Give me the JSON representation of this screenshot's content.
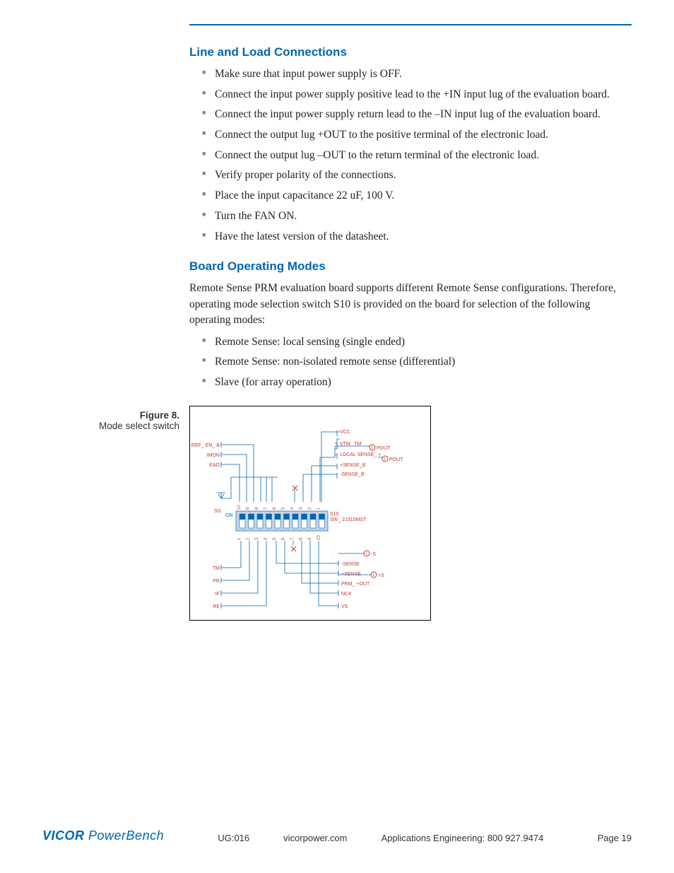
{
  "sections": {
    "line_load": {
      "title": "Line and Load Connections",
      "items": [
        "Make sure that input power supply is OFF.",
        "Connect the input power supply positive lead to the +IN input lug of the evaluation board.",
        "Connect the input power supply return lead to the –IN input lug of the evaluation board.",
        "Connect the output lug +OUT to the positive terminal of the electronic load.",
        "Connect the output lug –OUT to the return terminal of the electronic load.",
        "Verify proper polarity of the connections.",
        "Place the input capacitance 22 uF, 100 V.",
        "Turn the FAN ON.",
        "Have the latest version of the datasheet."
      ]
    },
    "board_modes": {
      "title": "Board Operating Modes",
      "intro": "Remote Sense PRM evaluation board supports different Remote Sense configurations. Therefore, operating mode selection switch S10 is provided on the board for selection of the following operating modes:",
      "items": [
        "Remote Sense: local sensing (single ended)",
        "Remote Sense: non-isolated remote sense (differential)",
        "Slave (for array operation)"
      ]
    }
  },
  "figure": {
    "number": "Figure 8.",
    "caption": "Mode select switch",
    "signals_left_top": [
      "REF_ EN_ B",
      "IMON",
      "EAO"
    ],
    "signals_left_bot": [
      "TM",
      "PR",
      "IF",
      "RE"
    ],
    "sg": "SG",
    "on": "ON",
    "switch_id": "S10",
    "switch_part": "SW_ 21910MST",
    "switch_top_nums": [
      "10",
      "9",
      "8",
      "7",
      "6",
      "5",
      "4",
      "3",
      "2",
      "1"
    ],
    "switch_bot_nums": [
      "1",
      "2",
      "3",
      "4",
      "5",
      "6",
      "7",
      "8",
      "9",
      "10"
    ],
    "signals_right_top": [
      "VCC",
      "VTM_ TM",
      "LOCAL  SENSE_ +",
      "+SENSE_B",
      "-SENSE_B"
    ],
    "pout1": "POUT",
    "pout2": "POUT",
    "signals_right_bot": [
      "-SENSE",
      "+SENSE",
      "PRM_ +OUT",
      "NC4",
      "VS"
    ],
    "minus_s": "-S",
    "plus_s": "+S"
  },
  "footer": {
    "ug": "UG:016",
    "site": "vicorpower.com",
    "phone": "Applications Engineering: 800 927.9474",
    "page": "Page 19",
    "logo_vicor": "VICOR",
    "logo_pb": "PowerBench"
  }
}
